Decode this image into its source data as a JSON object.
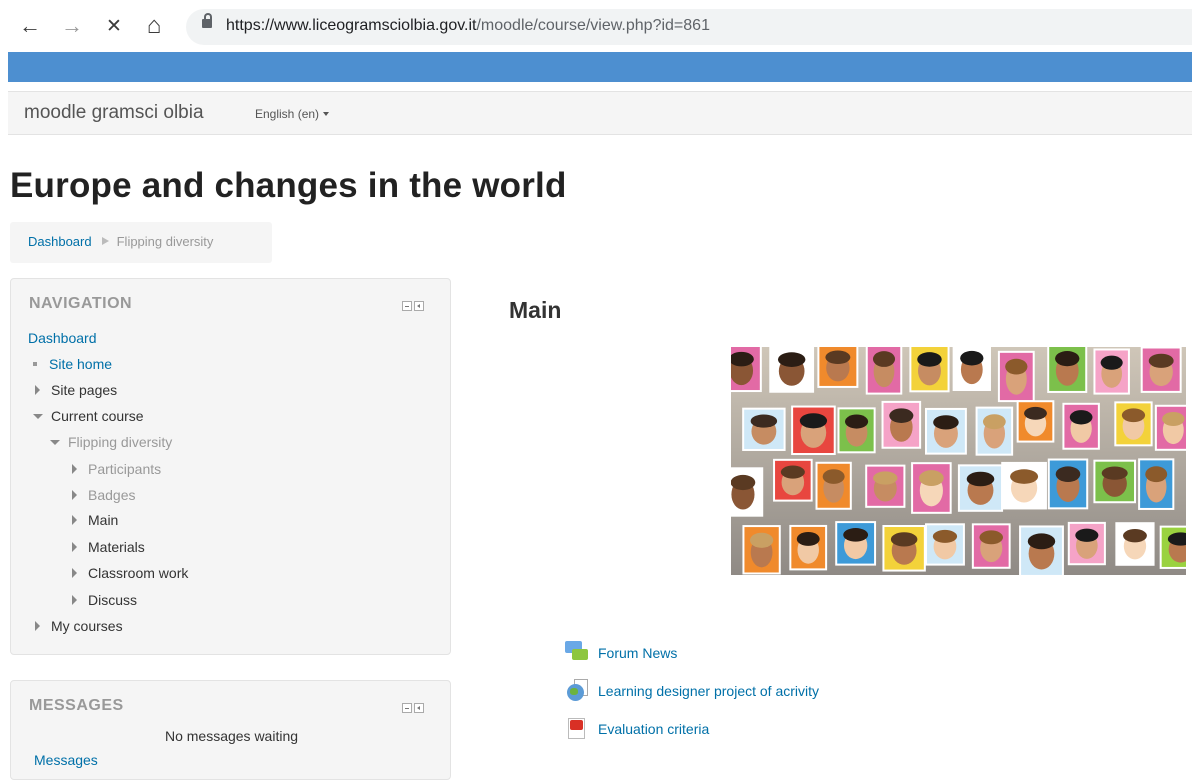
{
  "browser": {
    "back_glyph": "←",
    "forward_glyph": "→",
    "stop_glyph": "✕",
    "home_glyph": "⌂",
    "url_host": "https://www.liceogramsciolbia.gov.it",
    "url_path": "/moodle/course/view.php?id=861"
  },
  "site": {
    "brand": "moodle gramsci olbia",
    "language": "English (en)",
    "header_color": "#4d8fd0"
  },
  "page": {
    "title": "Europe and changes in the world"
  },
  "breadcrumb": {
    "home": "Dashboard",
    "current": "Flipping diversity"
  },
  "navigation": {
    "title": "NAVIGATION",
    "dashboard": "Dashboard",
    "site_home": "Site home",
    "site_pages": "Site pages",
    "current_course": "Current course",
    "course": "Flipping diversity",
    "participants": "Participants",
    "badges": "Badges",
    "main": "Main",
    "materials": "Materials",
    "classroom_work": "Classroom work",
    "discuss": "Discuss",
    "my_courses": "My courses"
  },
  "messages": {
    "title": "MESSAGES",
    "status": "No messages waiting",
    "link": "Messages"
  },
  "main": {
    "section_title": "Main",
    "image_icon": "diverse-faces-collage",
    "activities": [
      {
        "label": "Forum News",
        "icon": "forum-icon"
      },
      {
        "label": "Learning designer project of acrivity",
        "icon": "learning-designer-icon"
      },
      {
        "label": "Evaluation criteria",
        "icon": "pdf-icon"
      }
    ]
  }
}
